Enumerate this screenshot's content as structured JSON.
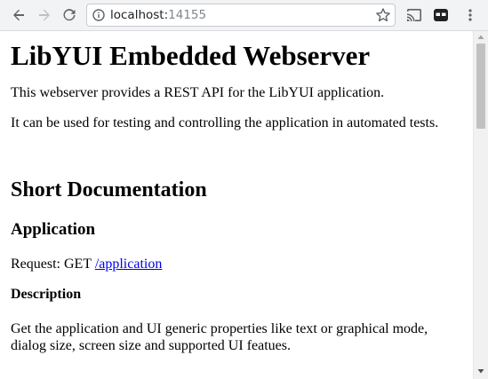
{
  "browser": {
    "url_host": "localhost:",
    "url_port": "14155",
    "icons": [
      "back-arrow-icon",
      "forward-arrow-icon",
      "reload-icon",
      "info-icon",
      "star-icon",
      "cast-icon",
      "extension-icon",
      "more-vert-icon"
    ]
  },
  "page": {
    "title": "LibYUI Embedded Webserver",
    "intro_1": "This webserver provides a REST API for the LibYUI application.",
    "intro_2": "It can be used for testing and controlling the application in automated tests.",
    "section_title": "Short Documentation",
    "app_heading": "Application",
    "request_prefix": "Request: GET ",
    "request_link": "/application",
    "desc_heading": "Description",
    "desc_text": "Get the application and UI generic properties like text or graphical mode, dialog size, screen size and supported UI featues."
  }
}
